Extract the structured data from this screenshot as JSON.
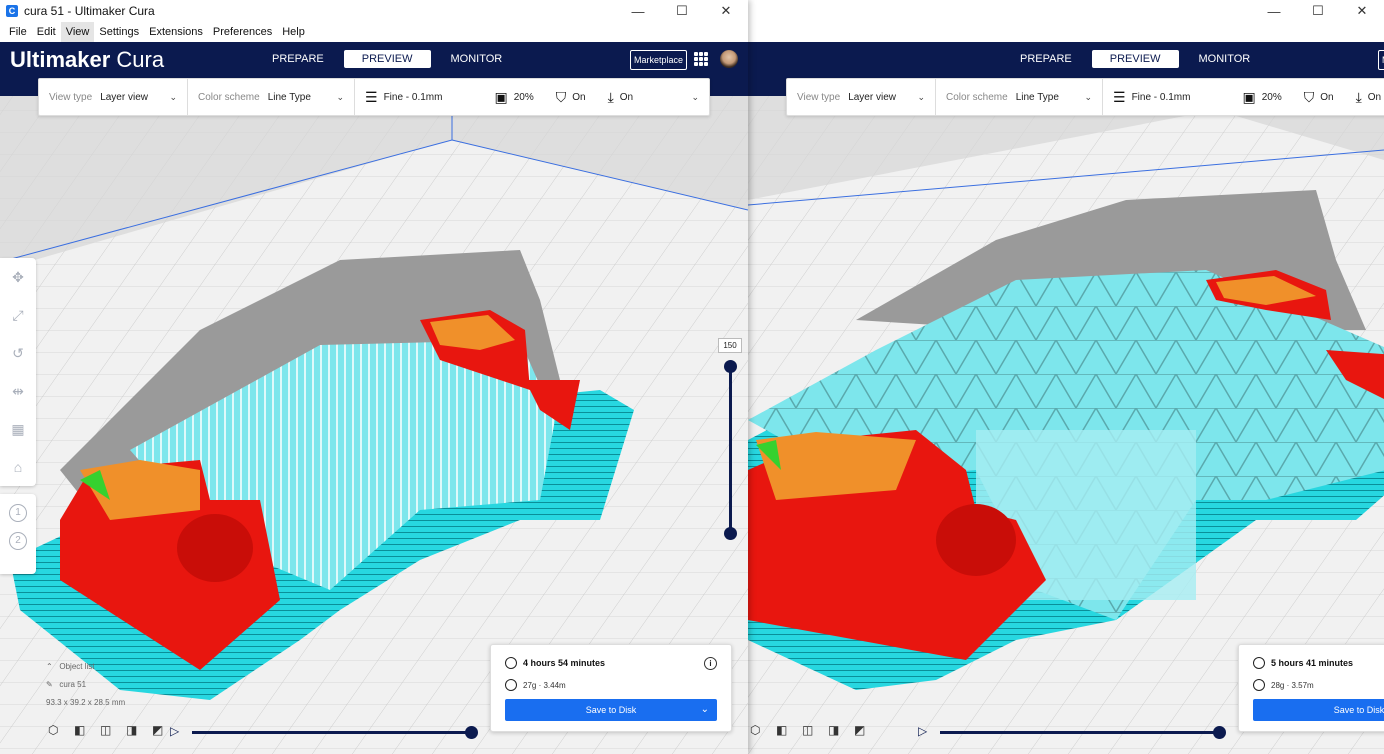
{
  "window_left": {
    "title": "cura 51 - Ultimaker Cura",
    "controls": [
      "—",
      "☐",
      "✕"
    ],
    "menu": [
      "File",
      "Edit",
      "View",
      "Settings",
      "Extensions",
      "Preferences",
      "Help"
    ],
    "active_menu": "View"
  },
  "window_right": {
    "controls": [
      "—",
      "☐",
      "✕"
    ]
  },
  "header": {
    "logo_bold": "Ultimaker",
    "logo_light": " Cura",
    "tabs": [
      "PREPARE",
      "PREVIEW",
      "MONITOR"
    ],
    "selected_tab": "PREVIEW",
    "marketplace": "Marketplace"
  },
  "viewbar": {
    "view_type_label": "View type",
    "view_type_value": "Layer view",
    "color_scheme_label": "Color scheme",
    "color_scheme_value": "Line Type",
    "profile": "Fine - 0.1mm",
    "infill": "20%",
    "support": "On",
    "adhesion": "On"
  },
  "layer_slider": {
    "max_label": "150"
  },
  "object": {
    "list_label": "Object list",
    "name": "cura 51",
    "dimensions": "93.3 x 39.2 x 28.5 mm"
  },
  "left_panel": {
    "time": "4 hours 54 minutes",
    "material": "27g · 3.44m",
    "save": "Save to Disk"
  },
  "right_panel": {
    "time": "5 hours 41 minutes",
    "material": "28g · 3.57m",
    "save": "Save to Disk"
  },
  "colors": {
    "header": "#0b1a4f",
    "accent": "#196ef0",
    "brim": "#27d7e0",
    "wall_outer": "#e8160f",
    "infill": "#f0902a",
    "support": "#7de6ec",
    "skirt_green": "#36d12f"
  }
}
